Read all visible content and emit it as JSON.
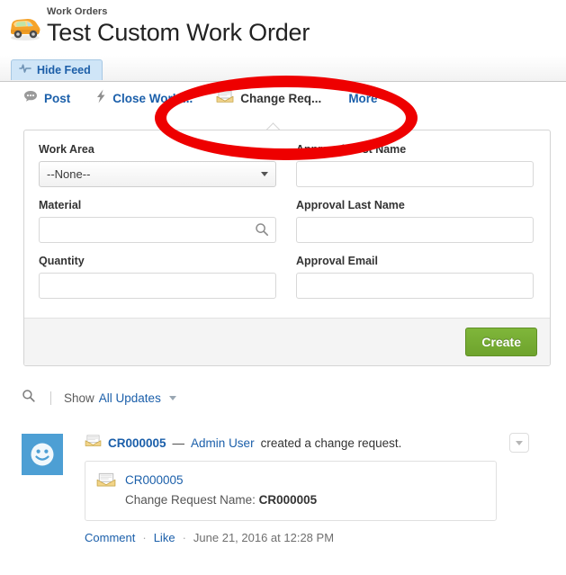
{
  "header": {
    "breadcrumb": "Work Orders",
    "title": "Test Custom Work Order",
    "record_icon": "truck-icon"
  },
  "tabs": {
    "feed_tab_label": "Hide Feed",
    "feed_tab_icon": "activity-pulse-icon"
  },
  "publisher": {
    "actions": [
      {
        "label": "Post",
        "icon": "speech-bubble-icon",
        "active": false
      },
      {
        "label": "Close Work ...",
        "icon": "lightning-bolt-icon",
        "active": false
      },
      {
        "label": "Change Req...",
        "icon": "envelope-icon",
        "active": true
      },
      {
        "label": "More",
        "icon": "chevron-down-icon",
        "active": false
      }
    ],
    "form": {
      "left": [
        {
          "label": "Work Area",
          "type": "select",
          "value": "--None--"
        },
        {
          "label": "Material",
          "type": "lookup",
          "value": "",
          "placeholder": ""
        },
        {
          "label": "Quantity",
          "type": "text",
          "value": "",
          "placeholder": ""
        }
      ],
      "right": [
        {
          "label": "Approval First Name",
          "type": "text",
          "value": "",
          "placeholder": ""
        },
        {
          "label": "Approval Last Name",
          "type": "text",
          "value": "",
          "placeholder": ""
        },
        {
          "label": "Approval Email",
          "type": "text",
          "value": "",
          "placeholder": ""
        }
      ],
      "submit_label": "Create"
    }
  },
  "feed_filter": {
    "search_icon": "search-icon",
    "show_label": "Show",
    "selected_filter": "All Updates"
  },
  "feed": {
    "item": {
      "avatar_icon": "smiley-avatar",
      "record_link": "CR000005",
      "dash": "—",
      "user": "Admin User",
      "action_text": "created a change request.",
      "record_icon": "envelope-icon",
      "card": {
        "icon": "envelope-icon",
        "title": "CR000005",
        "field_label": "Change Request Name:",
        "field_value": "CR000005"
      },
      "comment_label": "Comment",
      "like_label": "Like",
      "timestamp": "June 21, 2016 at 12:28 PM",
      "separator": "·"
    }
  },
  "colors": {
    "link": "#1b5faa",
    "create_button": "#7fb63a",
    "avatar_bg": "#4d9fd4",
    "annotation": "#ee0000",
    "active_tab_bg": "#cfe5f7"
  }
}
